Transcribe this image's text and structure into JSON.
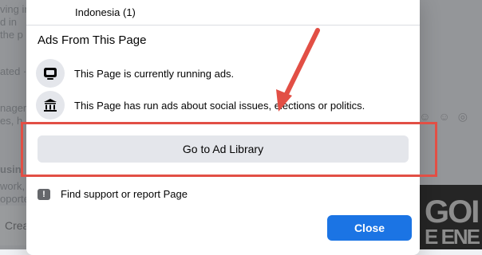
{
  "background": {
    "create_label": "Crea",
    "logo_text_1": "GOI",
    "logo_text_2": "E ENE"
  },
  "dialog": {
    "country_row": "Indonesia (1)",
    "ads_section": {
      "title": "Ads From This Page",
      "items": [
        {
          "icon": "monitor-icon",
          "text": "This Page is currently running ads."
        },
        {
          "icon": "institution-icon",
          "text": "This Page has run ads about social issues, elections or politics."
        }
      ]
    },
    "ad_library_button": "Go to Ad Library",
    "report_link": {
      "icon": "exclamation-icon",
      "text": "Find support or report Page"
    },
    "close_button": "Close",
    "colors": {
      "primary": "#1b74e4",
      "secondary_button": "#e4e6eb",
      "annotation": "#e24f45"
    }
  }
}
